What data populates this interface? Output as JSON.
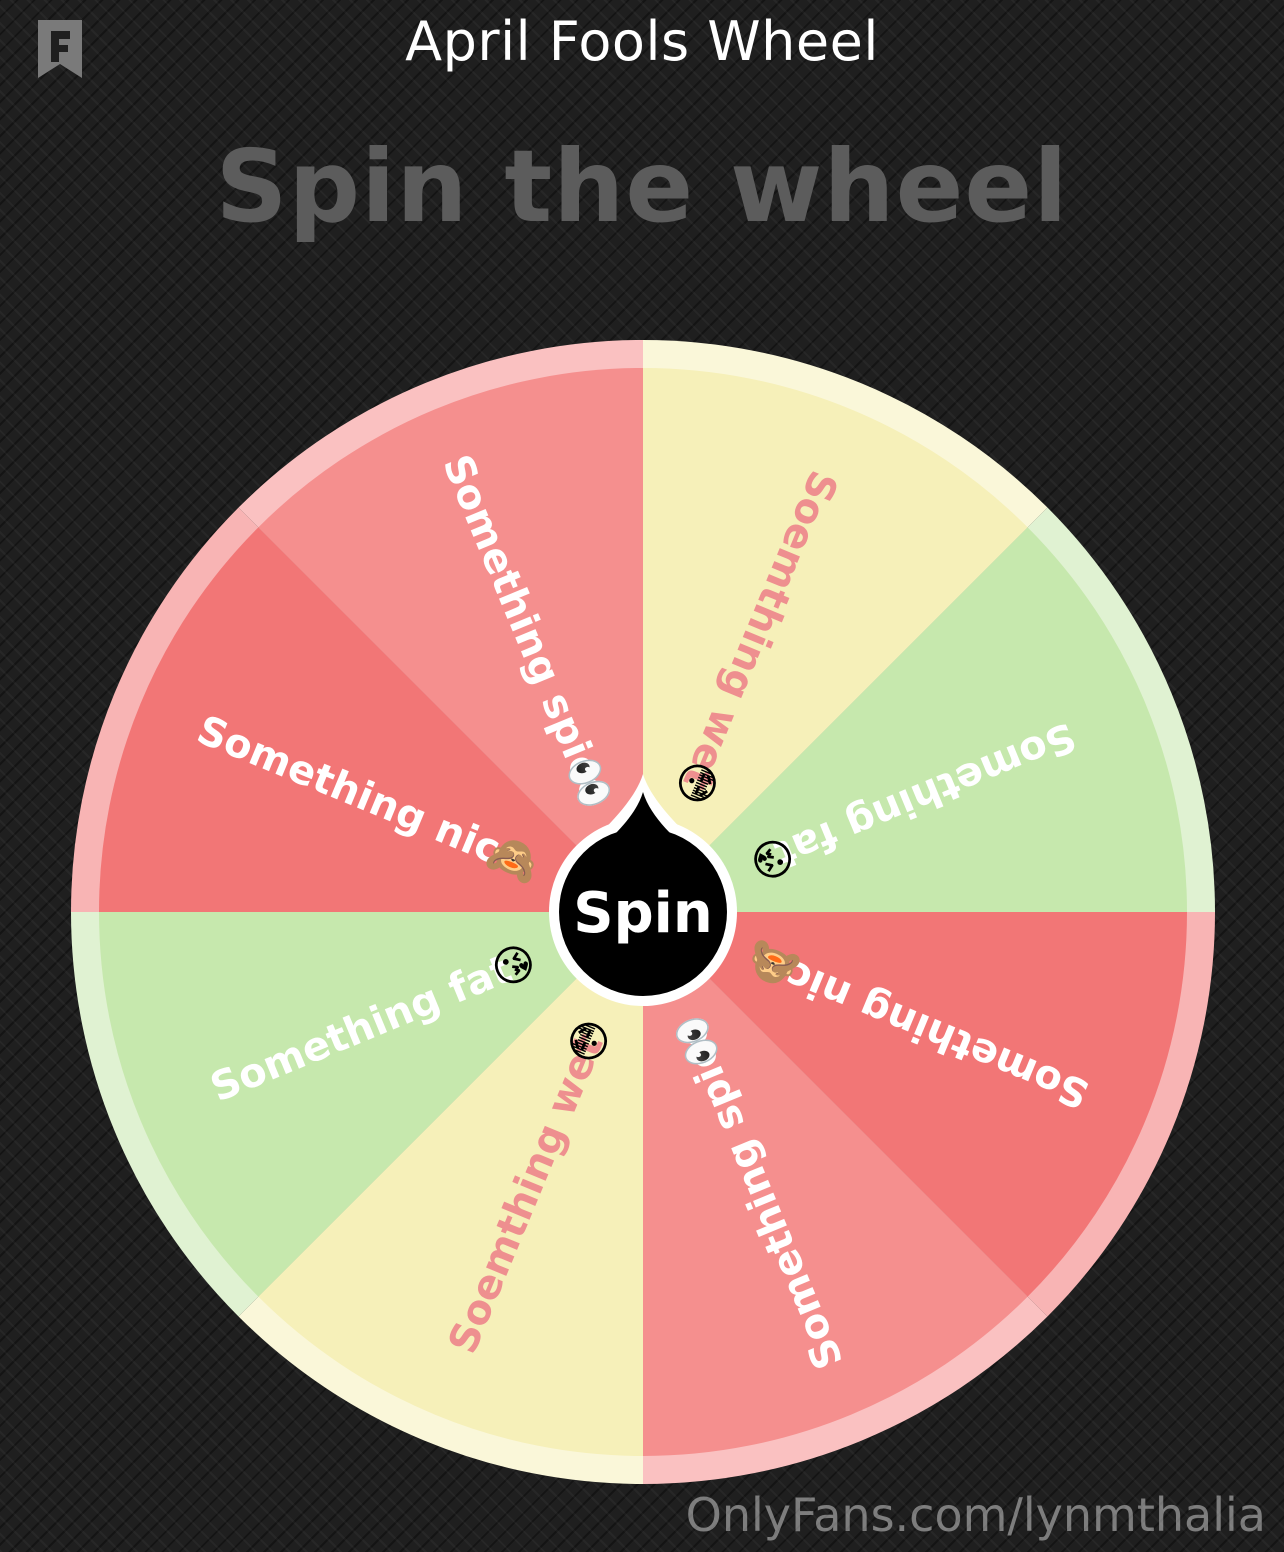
{
  "header": {
    "title": "April Fools Wheel",
    "logo_icon": "f-bookmark-icon"
  },
  "heading": "Spin the wheel",
  "wheel": {
    "spin_label": "Spin",
    "pointer_icon": "teardrop-pointer-icon",
    "segments": [
      {
        "label": "Soemthing wet",
        "emoji": "😳",
        "color": "#f6f0b9",
        "text_color": "#ee8f8f"
      },
      {
        "label": "Something fat",
        "emoji": "😘",
        "color": "#c6e8ad",
        "text_color": "#ffffff"
      },
      {
        "label": "Something nice",
        "emoji": "🙈",
        "color": "#f27676",
        "text_color": "#ffffff"
      },
      {
        "label": "Something spice",
        "emoji": "👀",
        "color": "#f58f8e",
        "text_color": "#ffffff"
      },
      {
        "label": "Soemthing wet",
        "emoji": "😳",
        "color": "#f6f0b9",
        "text_color": "#ee8f8f"
      },
      {
        "label": "Something fat",
        "emoji": "😘",
        "color": "#c6e8ad",
        "text_color": "#ffffff"
      },
      {
        "label": "Something nice",
        "emoji": "🙈",
        "color": "#f27676",
        "text_color": "#ffffff"
      },
      {
        "label": "Something spice",
        "emoji": "👀",
        "color": "#f58f8e",
        "text_color": "#ffffff"
      }
    ]
  },
  "watermark": "OnlyFans.com/lynmthalia"
}
